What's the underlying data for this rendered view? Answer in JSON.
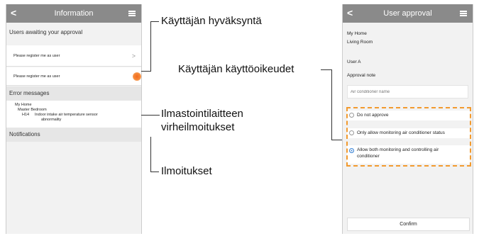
{
  "left_screen": {
    "header_title": "Information",
    "back_glyph": "<",
    "menu_icon": "hamburger-menu-icon",
    "approval_section": "Users awaiting your approval",
    "requests": [
      {
        "label": "Please register me as user",
        "chevron": ">"
      },
      {
        "label": "Please register me as user"
      }
    ],
    "errors_section": "Error messages",
    "error": {
      "home": "My Home",
      "room": "Master Bedroom",
      "code": "H14",
      "description_line1": "Indoor intake air temperature sensor",
      "description_line2": "abnormality"
    },
    "notifications_section": "Notifications"
  },
  "right_screen": {
    "header_title": "User approval",
    "back_glyph": "<",
    "home": "My Home",
    "room": "Living Room",
    "user": "User A",
    "approval_note_label": "Approval note",
    "approval_note_placeholder": "Air conditioner name",
    "options": [
      {
        "label": "Do not approve",
        "selected": false
      },
      {
        "label": "Only allow monitoring air conditioner status",
        "selected": false
      },
      {
        "label_line1": "Allow both monitoring and controlling air",
        "label_line2": "conditioner",
        "selected": true
      }
    ],
    "confirm_label": "Confirm"
  },
  "annotations": {
    "user_approval": "Käyttäjän hyväksyntä",
    "user_permissions": "Käyttäjän käyttöoikeudet",
    "error_line1": "Ilmastointilaitteen",
    "error_line2": "virheilmoitukset",
    "notifications": "Ilmoitukset"
  },
  "colors": {
    "header_bg": "#8a8a8a",
    "accent_orange": "#f29a2e",
    "radio_selected": "#3d86d6"
  }
}
